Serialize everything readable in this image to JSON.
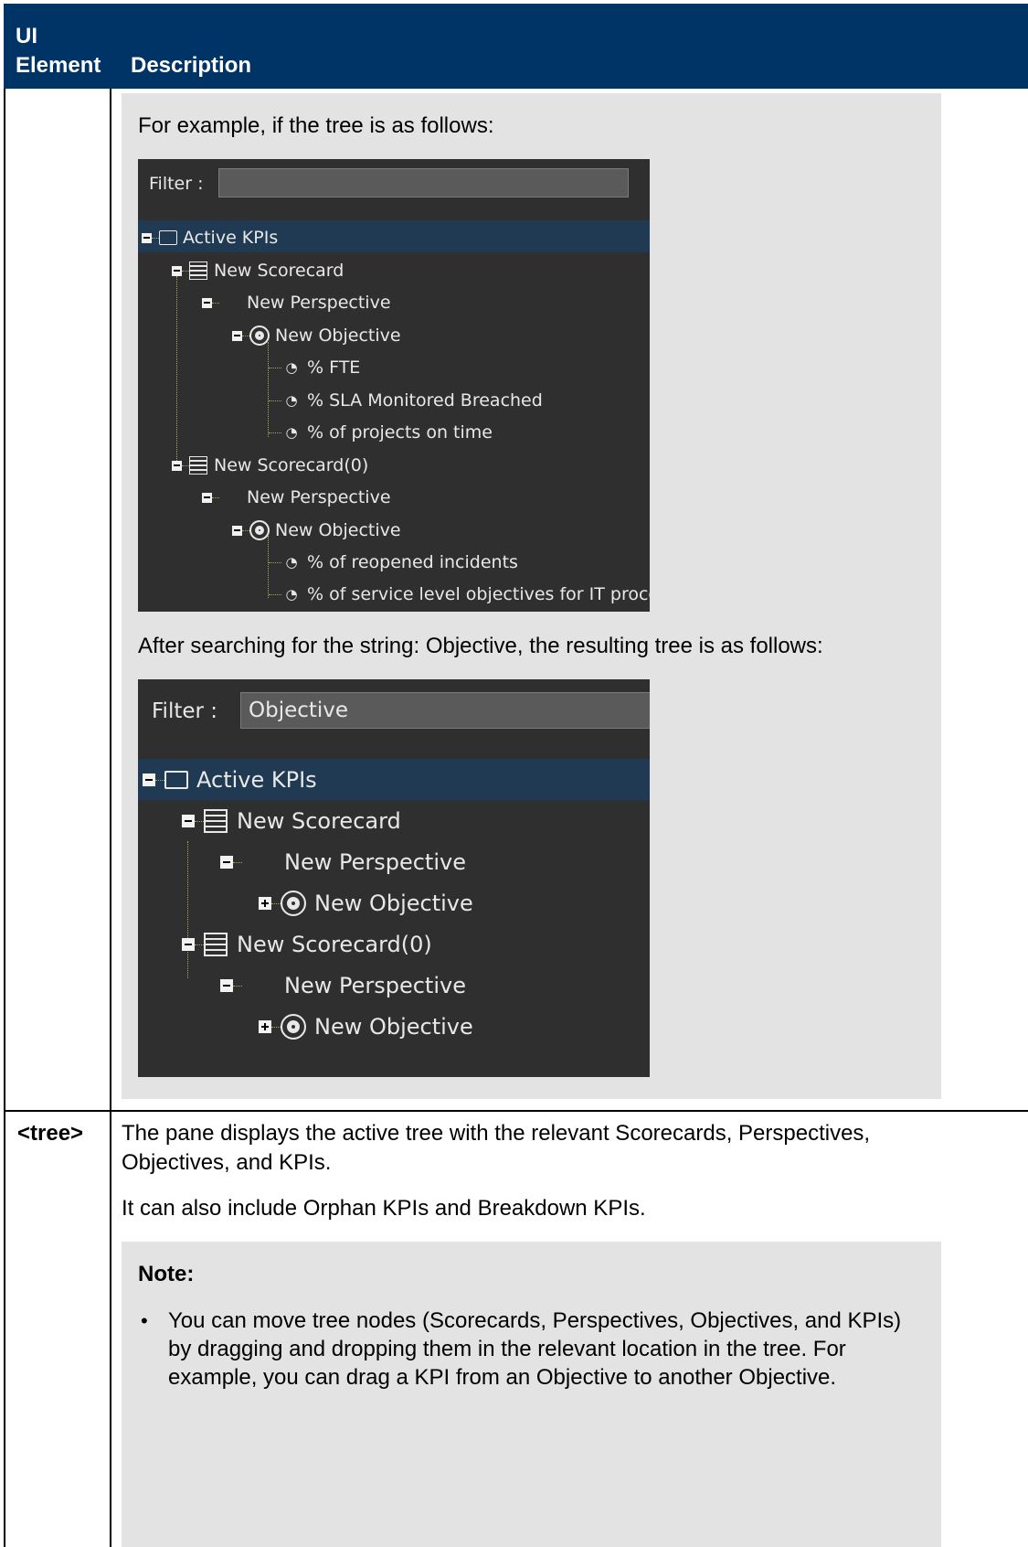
{
  "table": {
    "header": {
      "col1": "UI\nElement",
      "col1_line1": "UI",
      "col1_line2": "Element",
      "col2": "Description"
    }
  },
  "row1": {
    "intro": "For example, if the tree is as follows:",
    "after": "After searching for the string: Objective, the resulting tree is as follows:",
    "tree1": {
      "filter_label": "Filter :",
      "filter_value": "",
      "nodes": [
        {
          "label": "Active KPIs",
          "icon": "folder-icon",
          "toggle": "minus"
        },
        {
          "label": "New Scorecard",
          "icon": "scorecard-icon",
          "toggle": "minus"
        },
        {
          "label": "New Perspective",
          "icon": "none",
          "toggle": "minus"
        },
        {
          "label": "New Objective",
          "icon": "objective-icon",
          "toggle": "minus"
        },
        {
          "label": "% FTE",
          "icon": "kpi-gauge-icon"
        },
        {
          "label": "% SLA Monitored Breached",
          "icon": "kpi-gauge-icon"
        },
        {
          "label": "% of projects on time",
          "icon": "kpi-gauge-icon"
        },
        {
          "label": "New Scorecard(0)",
          "icon": "scorecard-icon",
          "toggle": "minus"
        },
        {
          "label": "New Perspective",
          "icon": "none",
          "toggle": "minus"
        },
        {
          "label": "New Objective",
          "icon": "objective-icon",
          "toggle": "minus"
        },
        {
          "label": "% of reopened incidents",
          "icon": "kpi-gauge-icon"
        },
        {
          "label": "% of service level objectives for IT process",
          "icon": "kpi-gauge-icon"
        }
      ]
    },
    "tree2": {
      "filter_label": "Filter :",
      "filter_value": "Objective",
      "nodes": [
        {
          "label": "Active KPIs",
          "icon": "folder-icon",
          "toggle": "minus"
        },
        {
          "label": "New Scorecard",
          "icon": "scorecard-icon",
          "toggle": "minus"
        },
        {
          "label": "New Perspective",
          "icon": "none",
          "toggle": "minus"
        },
        {
          "label": "New Objective",
          "icon": "objective-icon",
          "toggle": "plus"
        },
        {
          "label": "New Scorecard(0)",
          "icon": "scorecard-icon",
          "toggle": "minus"
        },
        {
          "label": "New Perspective",
          "icon": "none",
          "toggle": "minus"
        },
        {
          "label": "New Objective",
          "icon": "objective-icon",
          "toggle": "plus"
        }
      ]
    }
  },
  "row2": {
    "element": "<tree>",
    "desc1": "The pane displays the active tree with the relevant Scorecards, Perspectives, Objectives, and KPIs.",
    "desc2": "It can also include Orphan KPIs and Breakdown KPIs.",
    "note_title": "Note:",
    "note_items": [
      "You can move tree nodes (Scorecards, Perspectives, Objectives, and KPIs) by dragging and dropping them in the relevant location in the tree. For example, you can drag a KPI from an Objective to another Objective."
    ]
  },
  "colors": {
    "header_bg": "#003366",
    "shade_bg": "#e3e3e3",
    "tree_bg": "#2f2f2f",
    "tree_selected": "#1f3a52"
  }
}
